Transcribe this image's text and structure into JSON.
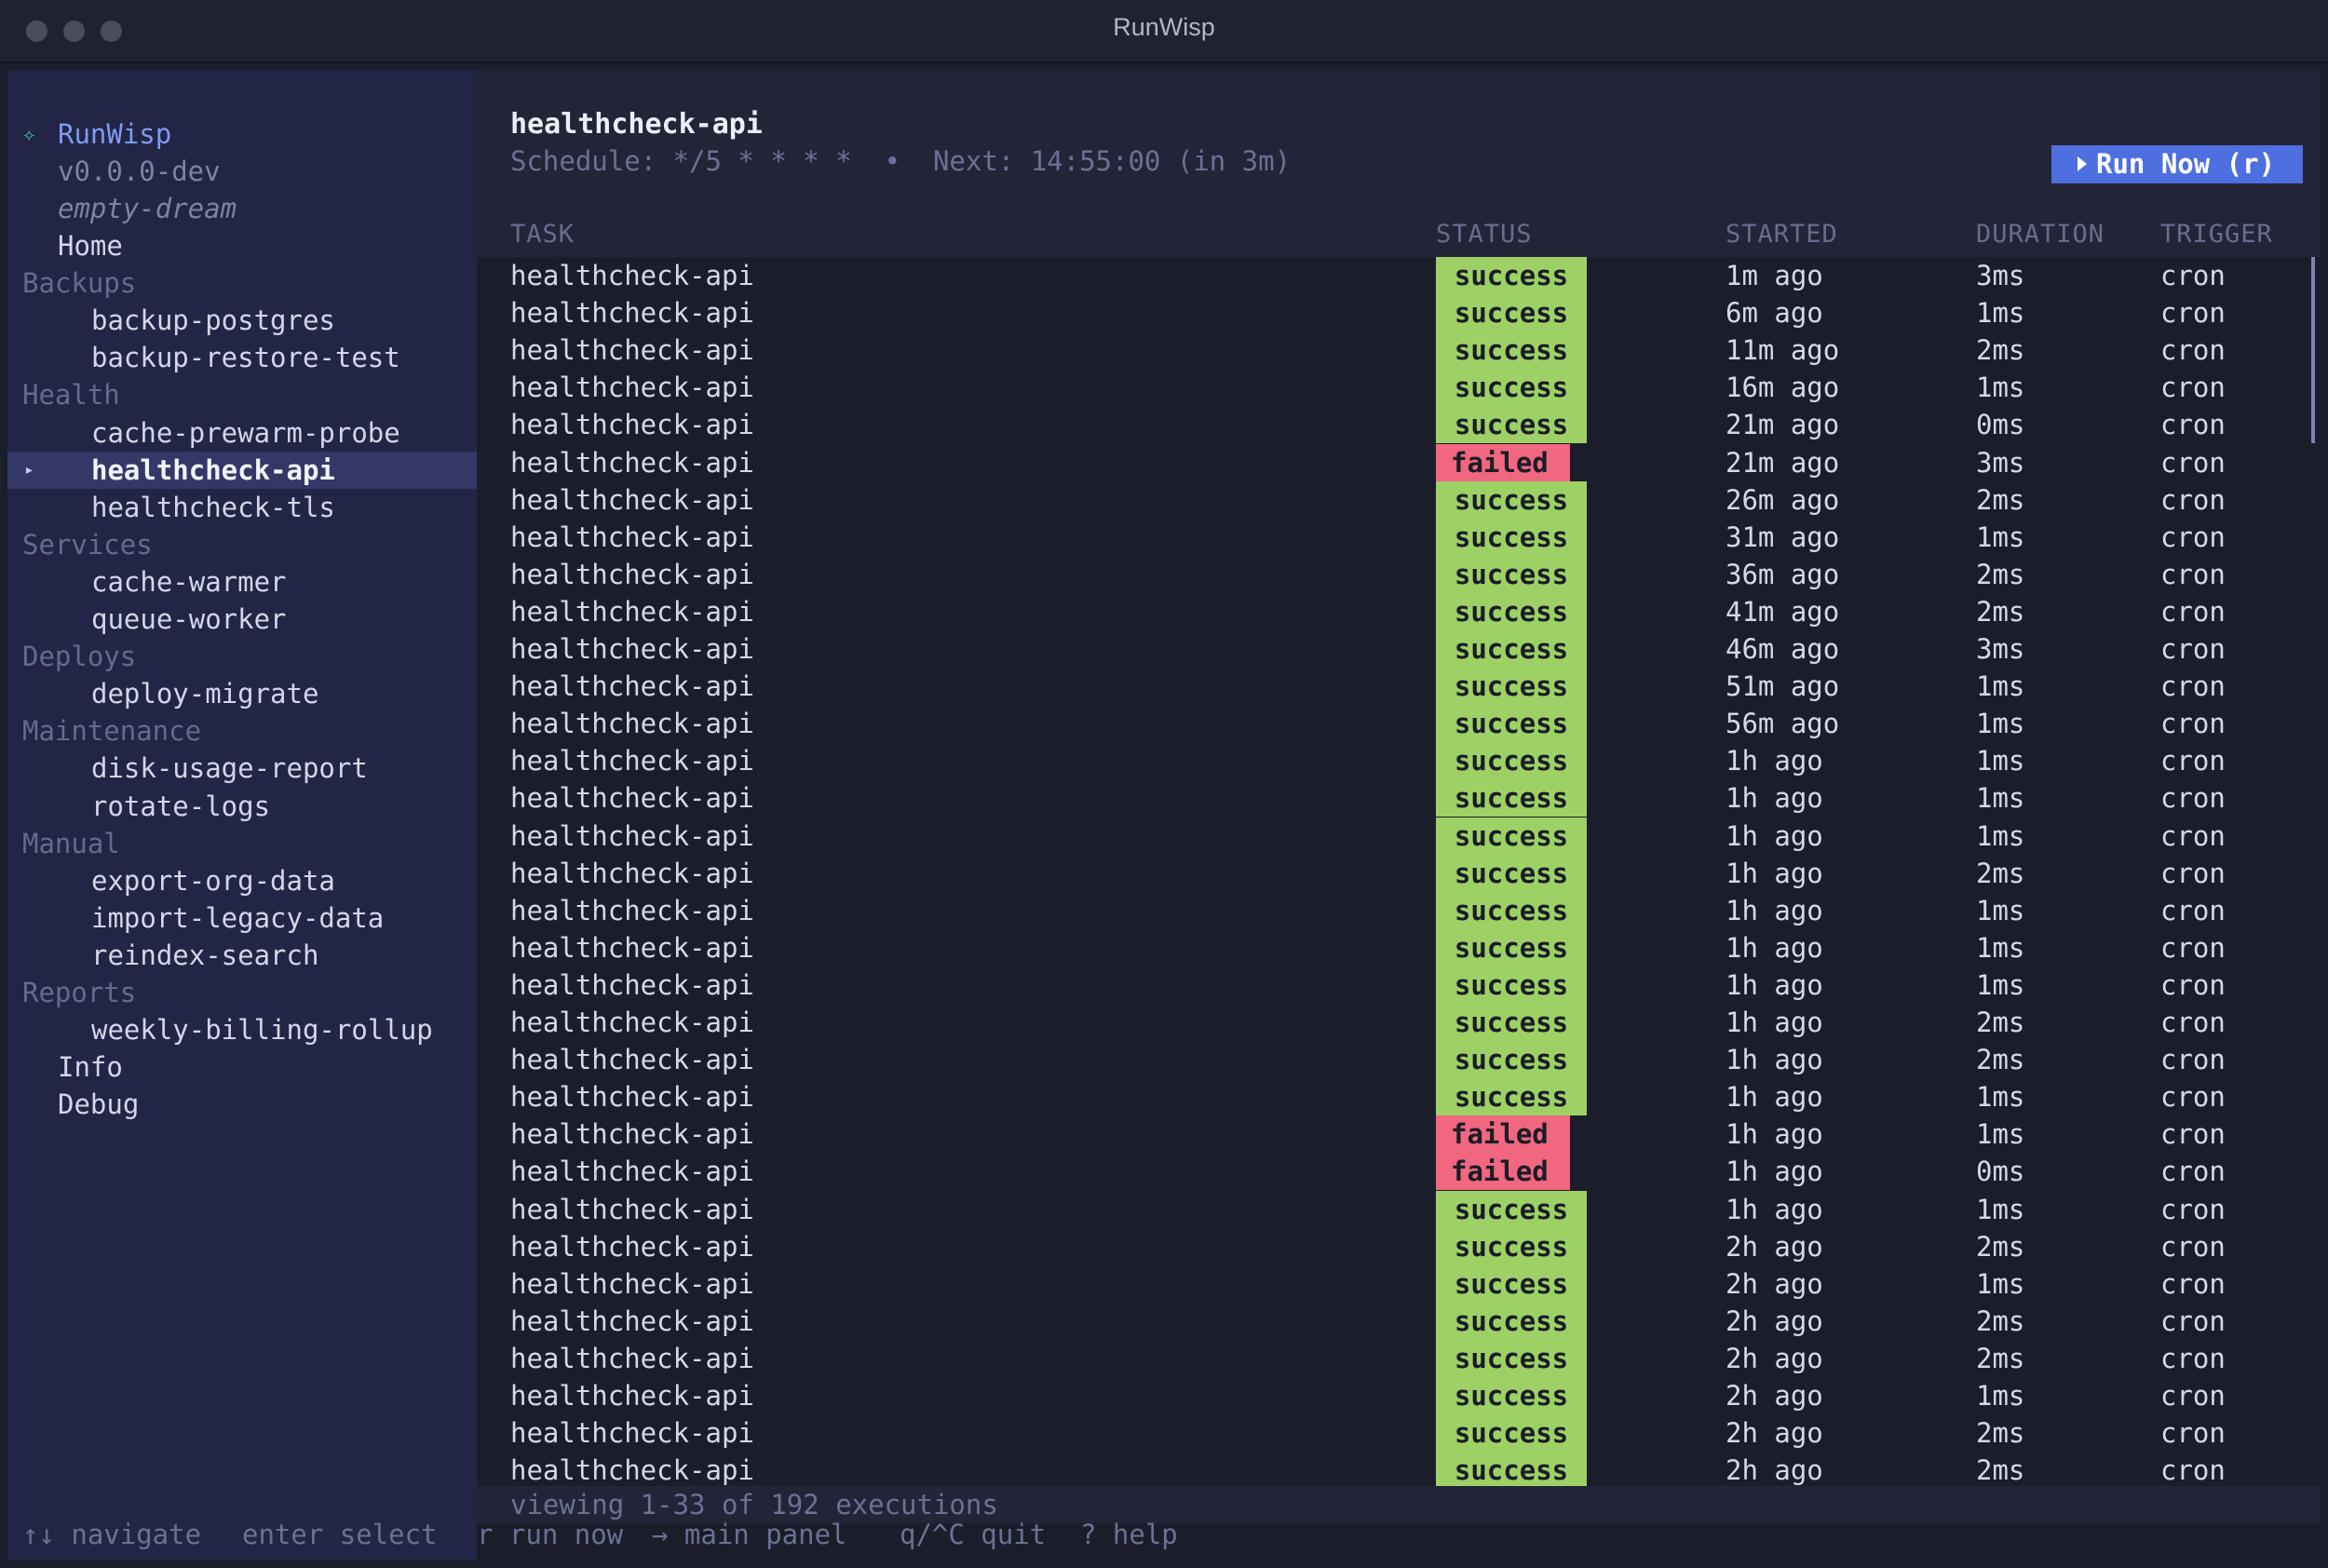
{
  "window": {
    "title": "RunWisp"
  },
  "sidebar": {
    "brand_icon": "✧",
    "brand_name": "RunWisp",
    "version": "v0.0.0-dev",
    "instance": "empty-dream",
    "selected_marker": "▸",
    "lines": [
      {
        "type": "top",
        "label": "Home"
      },
      {
        "type": "section",
        "label": "Backups"
      },
      {
        "type": "item",
        "label": "backup-postgres"
      },
      {
        "type": "item",
        "label": "backup-restore-test"
      },
      {
        "type": "section",
        "label": "Health"
      },
      {
        "type": "item",
        "label": "cache-prewarm-probe"
      },
      {
        "type": "item",
        "label": "healthcheck-api",
        "selected": true
      },
      {
        "type": "item",
        "label": "healthcheck-tls"
      },
      {
        "type": "section",
        "label": "Services"
      },
      {
        "type": "item",
        "label": "cache-warmer"
      },
      {
        "type": "item",
        "label": "queue-worker"
      },
      {
        "type": "section",
        "label": "Deploys"
      },
      {
        "type": "item",
        "label": "deploy-migrate"
      },
      {
        "type": "section",
        "label": "Maintenance"
      },
      {
        "type": "item",
        "label": "disk-usage-report"
      },
      {
        "type": "item",
        "label": "rotate-logs"
      },
      {
        "type": "section",
        "label": "Manual"
      },
      {
        "type": "item",
        "label": "export-org-data"
      },
      {
        "type": "item",
        "label": "import-legacy-data"
      },
      {
        "type": "item",
        "label": "reindex-search"
      },
      {
        "type": "section",
        "label": "Reports"
      },
      {
        "type": "item",
        "label": "weekly-billing-rollup"
      },
      {
        "type": "top",
        "label": "Info"
      },
      {
        "type": "top",
        "label": "Debug"
      }
    ]
  },
  "main": {
    "job_title": "healthcheck-api",
    "schedule_text": "Schedule: */5 * * * *  •  Next: 14:55:00 (in 3m)",
    "run_button": "Run Now (r)",
    "columns": {
      "task": "TASK",
      "status": "STATUS",
      "started": "STARTED",
      "duration": "DURATION",
      "trigger": "TRIGGER"
    },
    "status_colors": {
      "success": "#9dd165",
      "failed": "#f0677f"
    },
    "rows": [
      {
        "task": "healthcheck-api",
        "status": "success",
        "started": "1m ago",
        "duration": "3ms",
        "trigger": "cron"
      },
      {
        "task": "healthcheck-api",
        "status": "success",
        "started": "6m ago",
        "duration": "1ms",
        "trigger": "cron"
      },
      {
        "task": "healthcheck-api",
        "status": "success",
        "started": "11m ago",
        "duration": "2ms",
        "trigger": "cron"
      },
      {
        "task": "healthcheck-api",
        "status": "success",
        "started": "16m ago",
        "duration": "1ms",
        "trigger": "cron"
      },
      {
        "task": "healthcheck-api",
        "status": "success",
        "started": "21m ago",
        "duration": "0ms",
        "trigger": "cron"
      },
      {
        "task": "healthcheck-api",
        "status": "failed",
        "started": "21m ago",
        "duration": "3ms",
        "trigger": "cron"
      },
      {
        "task": "healthcheck-api",
        "status": "success",
        "started": "26m ago",
        "duration": "2ms",
        "trigger": "cron"
      },
      {
        "task": "healthcheck-api",
        "status": "success",
        "started": "31m ago",
        "duration": "1ms",
        "trigger": "cron"
      },
      {
        "task": "healthcheck-api",
        "status": "success",
        "started": "36m ago",
        "duration": "2ms",
        "trigger": "cron"
      },
      {
        "task": "healthcheck-api",
        "status": "success",
        "started": "41m ago",
        "duration": "2ms",
        "trigger": "cron"
      },
      {
        "task": "healthcheck-api",
        "status": "success",
        "started": "46m ago",
        "duration": "3ms",
        "trigger": "cron"
      },
      {
        "task": "healthcheck-api",
        "status": "success",
        "started": "51m ago",
        "duration": "1ms",
        "trigger": "cron"
      },
      {
        "task": "healthcheck-api",
        "status": "success",
        "started": "56m ago",
        "duration": "1ms",
        "trigger": "cron"
      },
      {
        "task": "healthcheck-api",
        "status": "success",
        "started": "1h ago",
        "duration": "1ms",
        "trigger": "cron"
      },
      {
        "task": "healthcheck-api",
        "status": "success",
        "started": "1h ago",
        "duration": "1ms",
        "trigger": "cron"
      },
      {
        "task": "healthcheck-api",
        "status": "success",
        "started": "1h ago",
        "duration": "1ms",
        "trigger": "cron"
      },
      {
        "task": "healthcheck-api",
        "status": "success",
        "started": "1h ago",
        "duration": "2ms",
        "trigger": "cron"
      },
      {
        "task": "healthcheck-api",
        "status": "success",
        "started": "1h ago",
        "duration": "1ms",
        "trigger": "cron"
      },
      {
        "task": "healthcheck-api",
        "status": "success",
        "started": "1h ago",
        "duration": "1ms",
        "trigger": "cron"
      },
      {
        "task": "healthcheck-api",
        "status": "success",
        "started": "1h ago",
        "duration": "1ms",
        "trigger": "cron"
      },
      {
        "task": "healthcheck-api",
        "status": "success",
        "started": "1h ago",
        "duration": "2ms",
        "trigger": "cron"
      },
      {
        "task": "healthcheck-api",
        "status": "success",
        "started": "1h ago",
        "duration": "2ms",
        "trigger": "cron"
      },
      {
        "task": "healthcheck-api",
        "status": "success",
        "started": "1h ago",
        "duration": "1ms",
        "trigger": "cron"
      },
      {
        "task": "healthcheck-api",
        "status": "failed",
        "started": "1h ago",
        "duration": "1ms",
        "trigger": "cron"
      },
      {
        "task": "healthcheck-api",
        "status": "failed",
        "started": "1h ago",
        "duration": "0ms",
        "trigger": "cron"
      },
      {
        "task": "healthcheck-api",
        "status": "success",
        "started": "1h ago",
        "duration": "1ms",
        "trigger": "cron"
      },
      {
        "task": "healthcheck-api",
        "status": "success",
        "started": "2h ago",
        "duration": "2ms",
        "trigger": "cron"
      },
      {
        "task": "healthcheck-api",
        "status": "success",
        "started": "2h ago",
        "duration": "1ms",
        "trigger": "cron"
      },
      {
        "task": "healthcheck-api",
        "status": "success",
        "started": "2h ago",
        "duration": "2ms",
        "trigger": "cron"
      },
      {
        "task": "healthcheck-api",
        "status": "success",
        "started": "2h ago",
        "duration": "2ms",
        "trigger": "cron"
      },
      {
        "task": "healthcheck-api",
        "status": "success",
        "started": "2h ago",
        "duration": "1ms",
        "trigger": "cron"
      },
      {
        "task": "healthcheck-api",
        "status": "success",
        "started": "2h ago",
        "duration": "2ms",
        "trigger": "cron"
      },
      {
        "task": "healthcheck-api",
        "status": "success",
        "started": "2h ago",
        "duration": "2ms",
        "trigger": "cron"
      }
    ],
    "pagination": "viewing 1-33 of 192 executions"
  },
  "footer": {
    "hints": [
      {
        "text": "↑↓ navigate"
      },
      {
        "text": "enter select"
      },
      {
        "text": "r run now"
      },
      {
        "text": "→ main panel"
      },
      {
        "text": "q/^C quit"
      },
      {
        "text": "? help"
      }
    ]
  }
}
